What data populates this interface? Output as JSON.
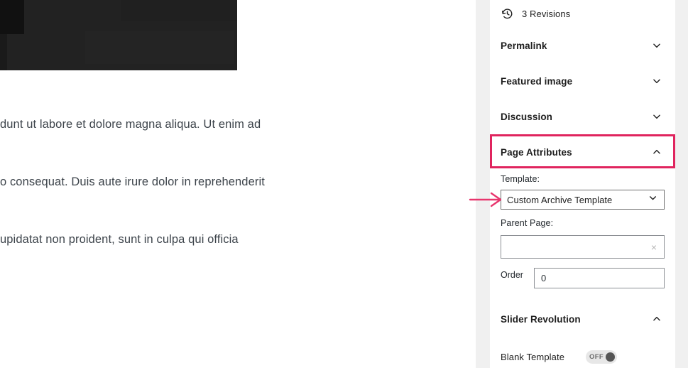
{
  "editor": {
    "featured_media": {
      "alt": "dark featured image",
      "bg_color": "#222222"
    },
    "body_lines": [
      "dunt ut labore et dolore magna aliqua. Ut enim ad",
      "o consequat. Duis aute irure dolor in reprehenderit",
      "upidatat non proident, sunt in culpa qui officia"
    ]
  },
  "sidebar": {
    "revisions": {
      "label": "3 Revisions",
      "icon": "revision-history-icon"
    },
    "sections": [
      {
        "label": "Permalink",
        "state": "collapsed",
        "chevron": "chevron-down-icon"
      },
      {
        "label": "Featured image",
        "state": "collapsed",
        "chevron": "chevron-down-icon"
      },
      {
        "label": "Discussion",
        "state": "collapsed",
        "chevron": "chevron-down-icon"
      },
      {
        "label": "Page Attributes",
        "state": "expanded",
        "chevron": "chevron-up-icon"
      },
      {
        "label": "Slider Revolution",
        "state": "expanded",
        "chevron": "chevron-up-icon"
      }
    ],
    "page_attributes": {
      "template_label": "Template:",
      "template_value": "Custom Archive Template",
      "template_chevron": "chevron-down-icon",
      "parent_label": "Parent Page:",
      "parent_value": "",
      "parent_clear_icon": "×",
      "order_label": "Order",
      "order_value": "0"
    },
    "slider_revolution": {
      "blank_template_label": "Blank Template",
      "blank_template_state": "OFF"
    }
  },
  "annotations": {
    "highlight_color": "#e0245e",
    "arrow_color": "#e8356d",
    "arrow_target": "template-select"
  }
}
